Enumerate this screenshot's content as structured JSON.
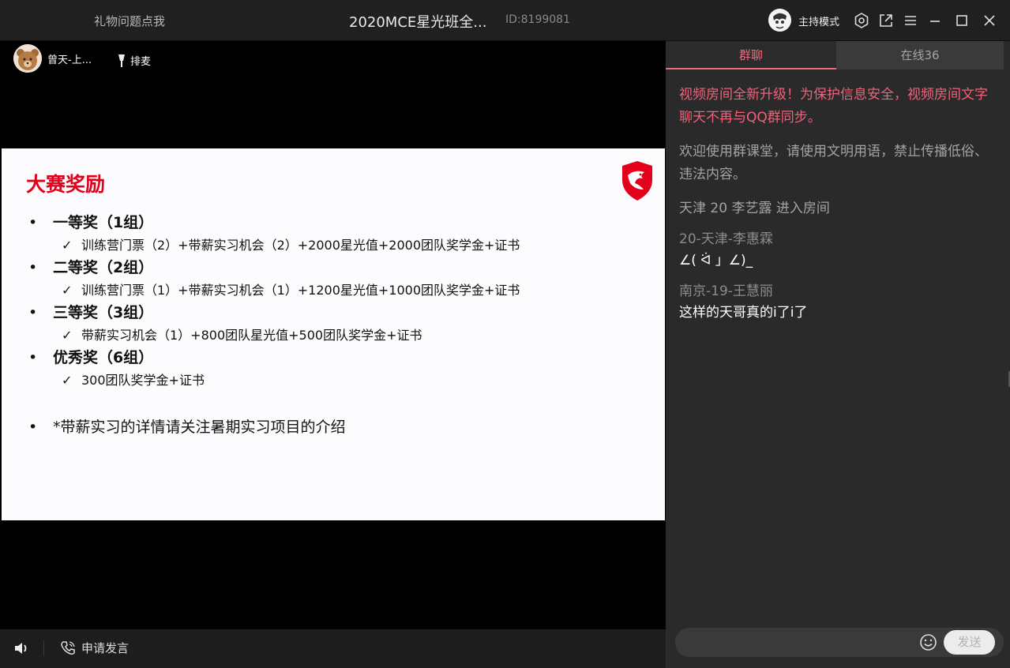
{
  "window": {
    "left_label": "礼物问题点我",
    "title": "2020MCE星光班全...",
    "room_id": "ID:8199081",
    "mode_label": "主持模式",
    "icons": [
      "settings-icon",
      "popout-icon",
      "menu-icon",
      "minimize-icon",
      "maximize-icon",
      "close-icon"
    ]
  },
  "presenter": {
    "name": "曾天-上...",
    "mic_queue_label": "排麦"
  },
  "slide": {
    "title": "大赛奖励",
    "logo": "dragon-shield-logo",
    "items": [
      {
        "level": 1,
        "text": "一等奖（1组）"
      },
      {
        "level": 2,
        "text": "训练营门票（2）+带薪实习机会（2）+2000星光值+2000团队奖学金+证书"
      },
      {
        "level": 1,
        "text": "二等奖（2组）"
      },
      {
        "level": 2,
        "text": "训练营门票（1）+带薪实习机会（1）+1200星光值+1000团队奖学金+证书"
      },
      {
        "level": 1,
        "text": "三等奖（3组）"
      },
      {
        "level": 2,
        "text": "带薪实习机会（1）+800团队星光值+500团队奖学金+证书"
      },
      {
        "level": 1,
        "text": "优秀奖（6组）"
      },
      {
        "level": 2,
        "text": "300团队奖学金+证书"
      }
    ],
    "note": "*带薪实习的详情请关注暑期实习项目的介绍"
  },
  "bottom": {
    "apply_label": "申请发言"
  },
  "chat": {
    "tab_group": "群聊",
    "tab_online": "在线36",
    "notice": "视频房间全新升级！为保护信息安全，视频房间文字聊天不再与QQ群同步。",
    "system": "欢迎使用群课堂，请使用文明用语，禁止传播低俗、违法内容。",
    "join": "天津 20 李艺露 进入房间",
    "messages": [
      {
        "name": "20-天津-李惠霖",
        "text": "∠( ᐛ 」∠)_"
      },
      {
        "name": "南京-19-王慧丽",
        "text": "这样的天哥真的i了i了"
      }
    ],
    "send_label": "发送",
    "input_placeholder": ""
  },
  "colors": {
    "accent": "#ef6a7c",
    "slide_title": "#e2001a",
    "panel": "#2a2a2a"
  }
}
